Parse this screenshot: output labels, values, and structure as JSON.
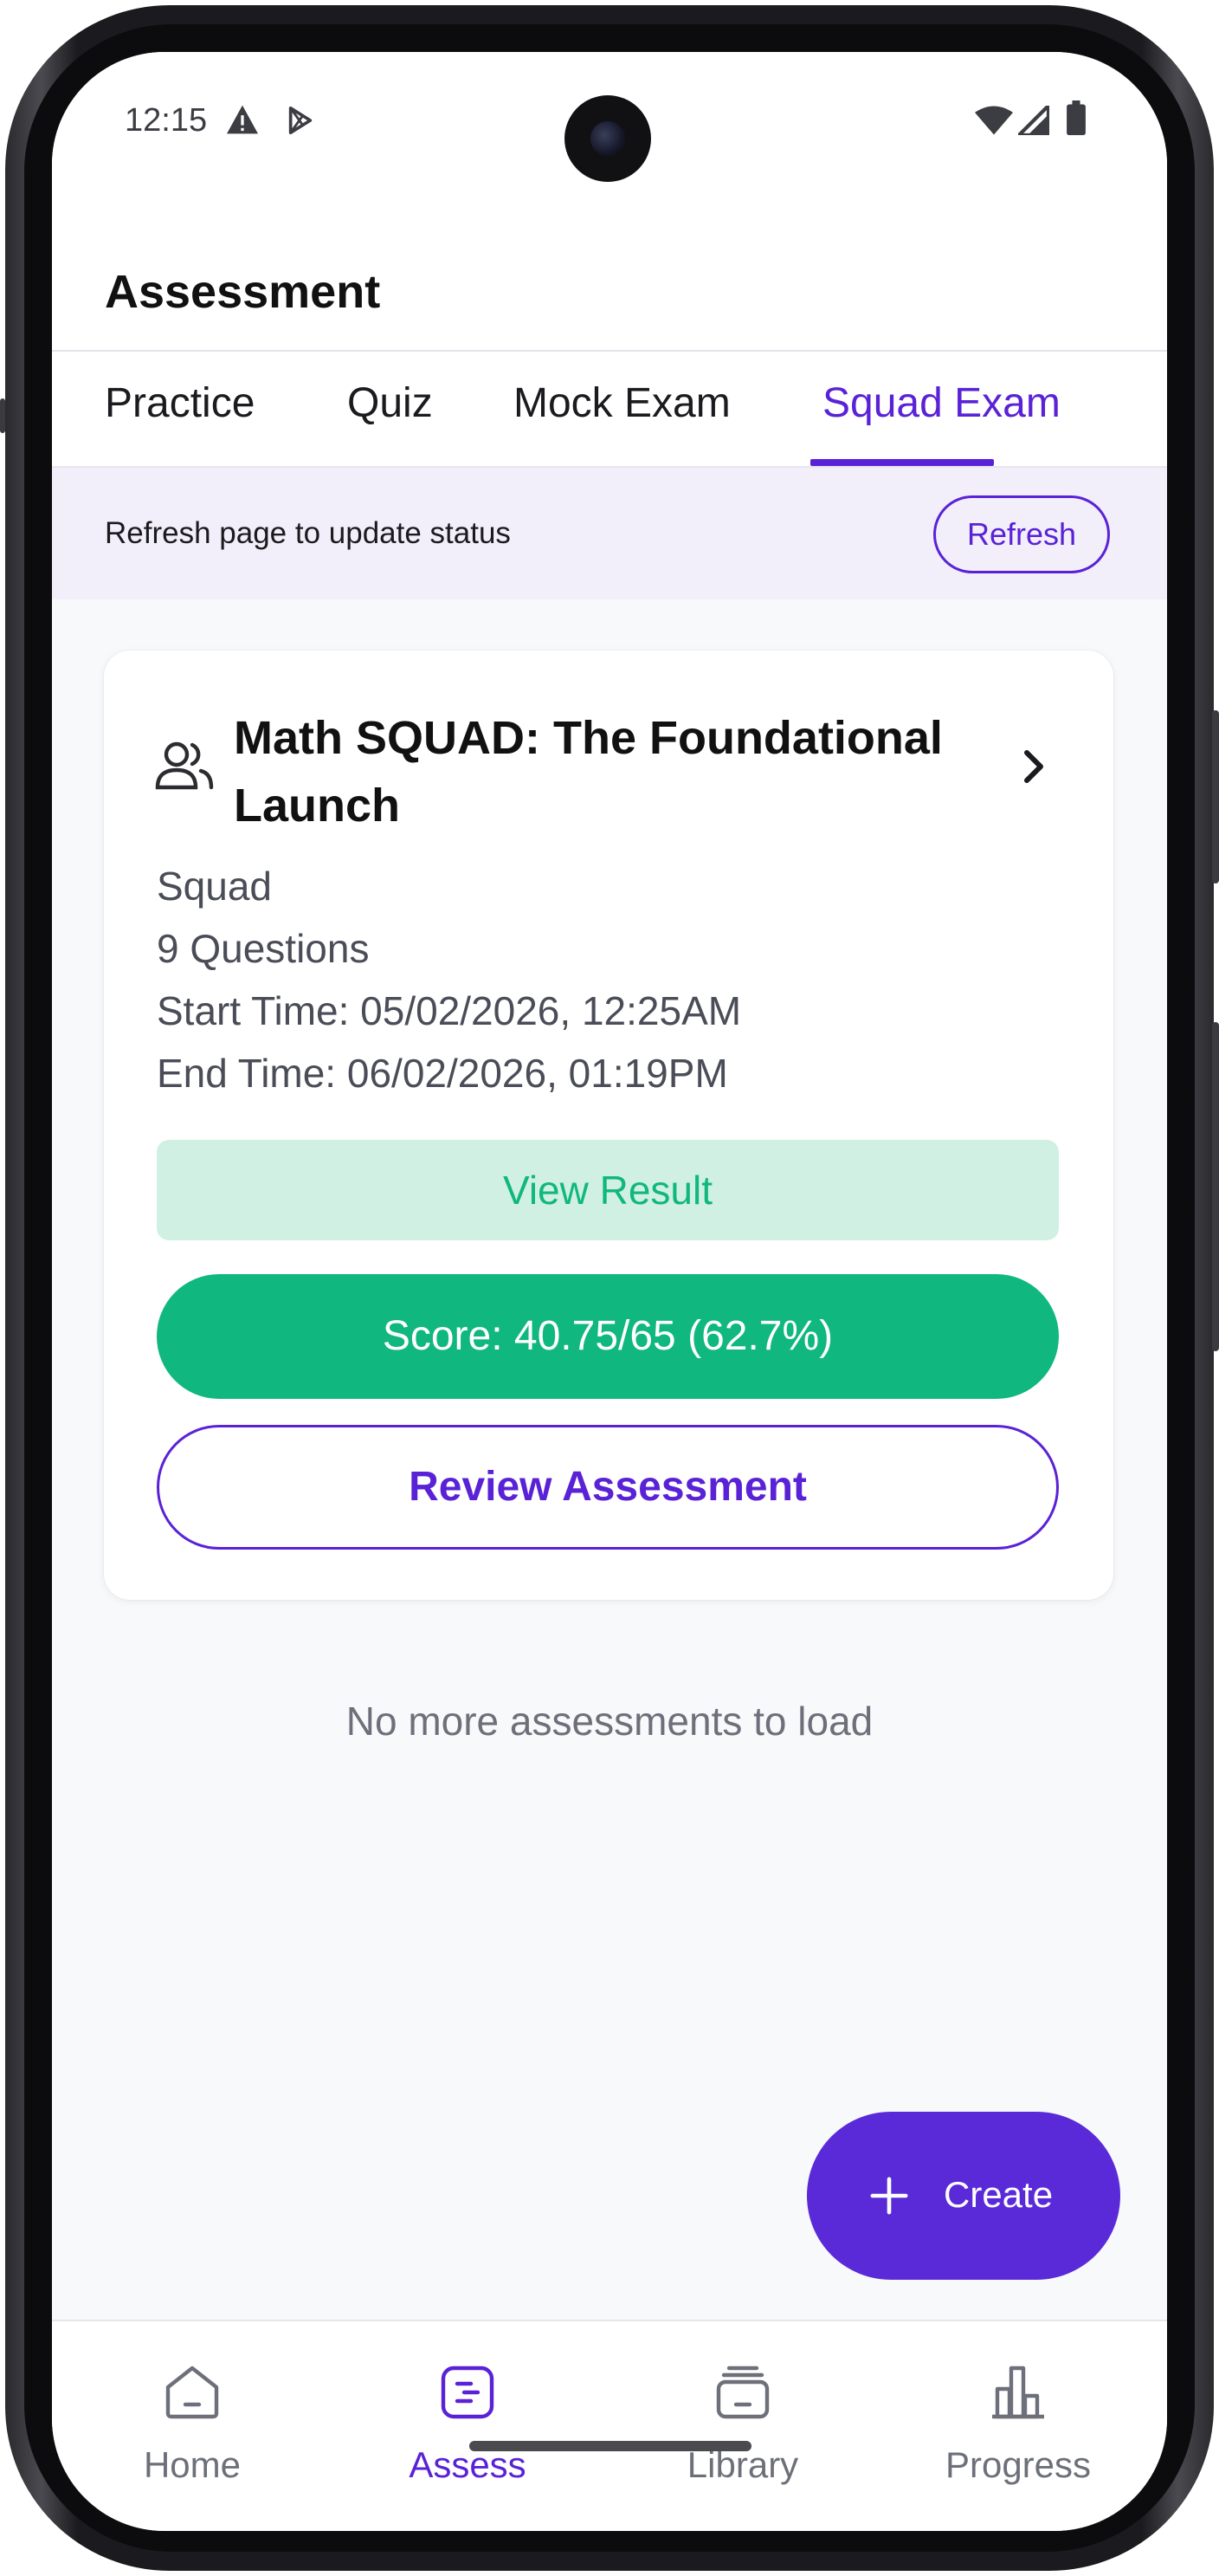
{
  "status_bar": {
    "time": "12:15"
  },
  "header": {
    "title": "Assessment"
  },
  "tabs": [
    {
      "label": "Practice",
      "active": false
    },
    {
      "label": "Quiz",
      "active": false
    },
    {
      "label": "Mock Exam",
      "active": false
    },
    {
      "label": "Squad Exam",
      "active": true
    }
  ],
  "banner": {
    "text": "Refresh page to update status",
    "button_label": "Refresh"
  },
  "assessment_card": {
    "icon": "users-icon",
    "title": "Math SQUAD: The Foundational Launch",
    "type": "Squad",
    "questions": "9 Questions",
    "start_time": "Start Time: 05/02/2026, 12:25AM",
    "end_time": "End Time: 06/02/2026, 01:19PM",
    "view_result_label": "View Result",
    "score_label": "Score: 40.75/65 (62.7%)",
    "review_label": "Review Assessment"
  },
  "list_end_text": "No more assessments to load",
  "fab": {
    "label": "Create"
  },
  "bottom_nav": [
    {
      "label": "Home",
      "icon": "home-icon",
      "active": false
    },
    {
      "label": "Assess",
      "icon": "assess-icon",
      "active": true
    },
    {
      "label": "Library",
      "icon": "library-icon",
      "active": false
    },
    {
      "label": "Progress",
      "icon": "progress-icon",
      "active": false
    }
  ],
  "colors": {
    "accent": "#5a22d6",
    "success": "#10b77f",
    "success_light": "#d1f0e4",
    "banner_bg": "#f2effa"
  }
}
